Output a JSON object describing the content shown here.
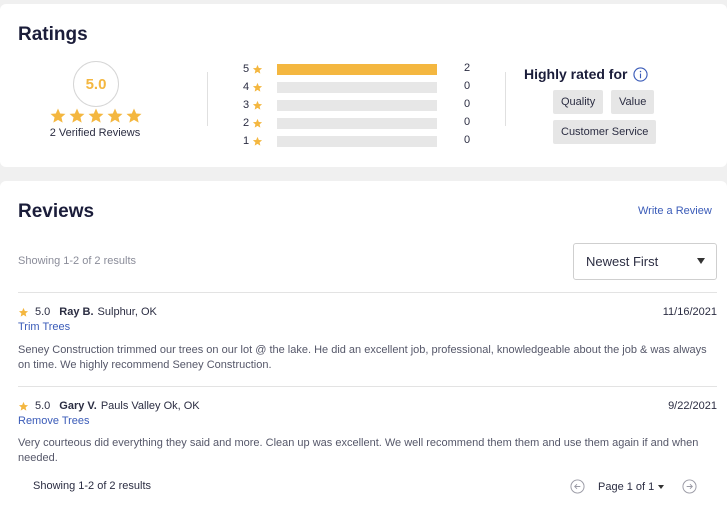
{
  "ratings": {
    "title": "Ratings",
    "score": "5.0",
    "verified": "2 Verified Reviews",
    "star_color": "#f4b740",
    "stars_filled": 5,
    "distribution": [
      {
        "stars": "5",
        "count": "2",
        "fraction": 1.0
      },
      {
        "stars": "4",
        "count": "0",
        "fraction": 0
      },
      {
        "stars": "3",
        "count": "0",
        "fraction": 0
      },
      {
        "stars": "2",
        "count": "0",
        "fraction": 0
      },
      {
        "stars": "1",
        "count": "0",
        "fraction": 0
      }
    ],
    "highly_rated_title": "Highly rated for",
    "info_icon": "info-icon",
    "tags": [
      "Quality",
      "Value",
      "Customer Service"
    ]
  },
  "reviews": {
    "title": "Reviews",
    "write_link": "Write a Review",
    "showing_top": "Showing 1-2 of 2 results",
    "sort_value": "Newest First",
    "items": [
      {
        "score": "5.0",
        "name": "Ray B.",
        "location": "Sulphur, OK",
        "date": "11/16/2021",
        "service": "Trim Trees",
        "text": "Seney Construction trimmed our trees on our lot @ the lake. He did an excellent job, professional, knowledgeable about the job & was always on time. We highly recommend Seney Construction."
      },
      {
        "score": "5.0",
        "name": "Gary V.",
        "location": "Pauls Valley Ok, OK",
        "date": "9/22/2021",
        "service": "Remove Trees",
        "text": "Very courteous did everything they said and more. Clean up was excellent. We well recommend them them and use them again if and when needed."
      }
    ],
    "showing_bottom": "Showing 1-2 of 2 results",
    "page_label": "Page 1 of 1"
  }
}
